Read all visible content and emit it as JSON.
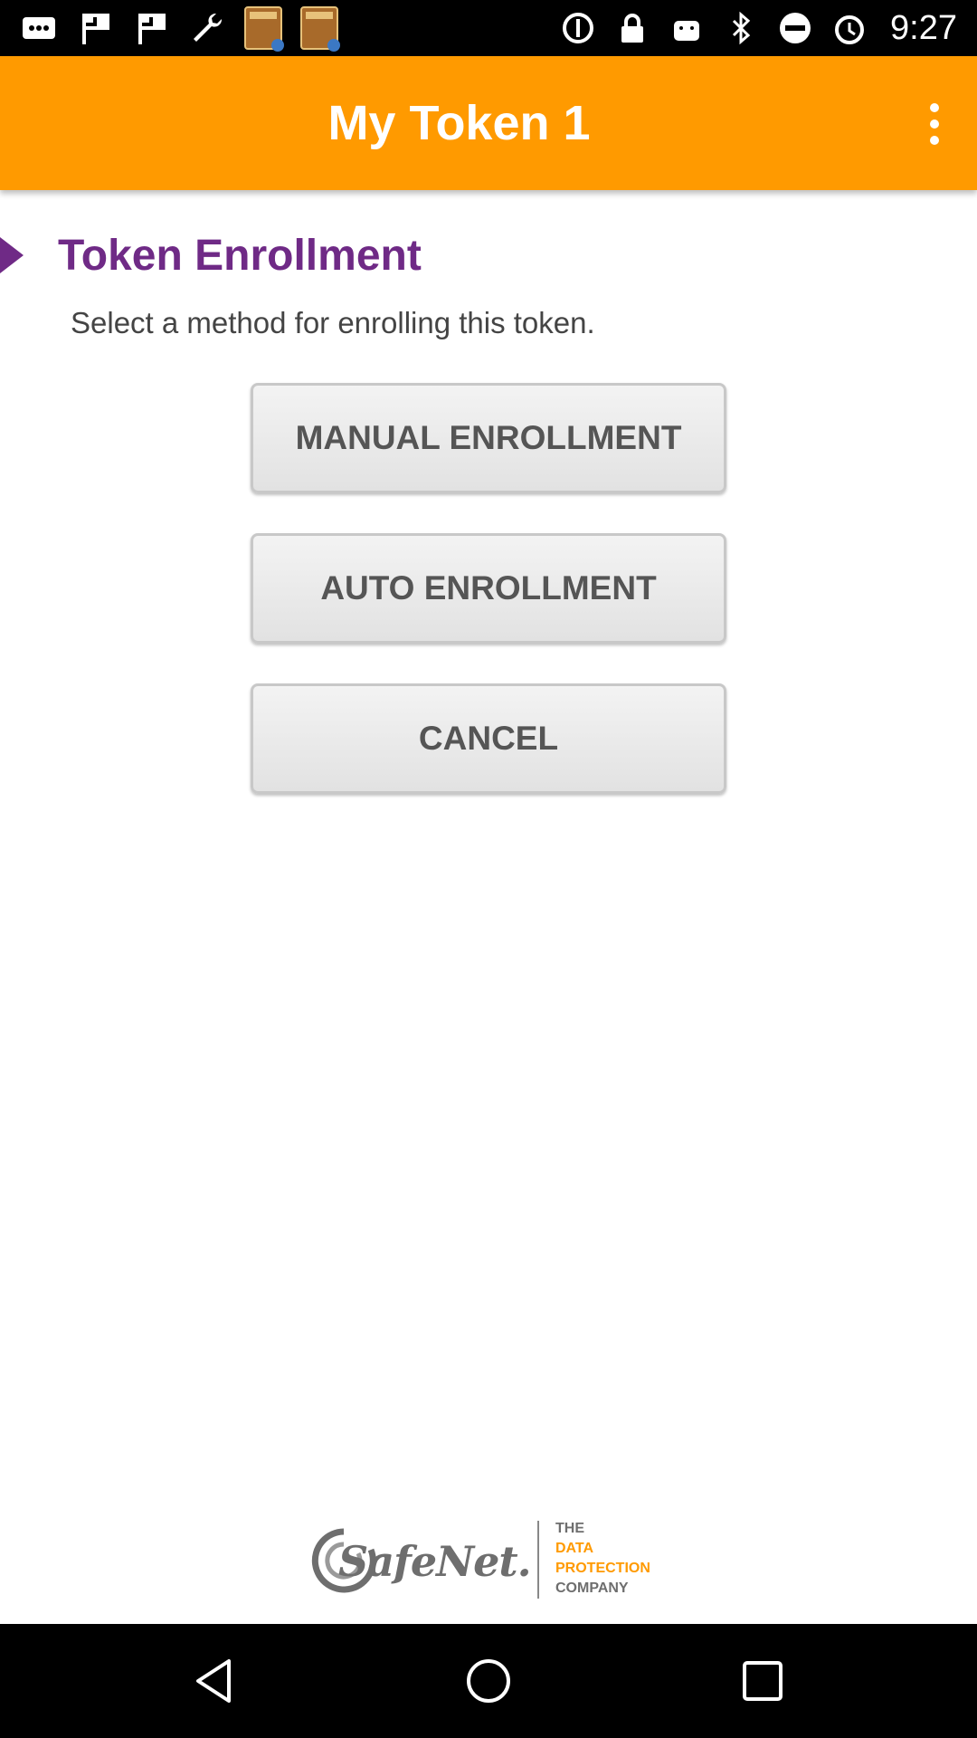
{
  "status_bar": {
    "left_icons": [
      "messages-icon",
      "flag-icon",
      "flag-icon",
      "wrench-icon",
      "topics-app-icon",
      "topics-app-icon"
    ],
    "right_icons": [
      "sync-icon",
      "lock-icon",
      "android-icon",
      "bluetooth-icon",
      "do-not-disturb-icon",
      "alarm-icon"
    ],
    "time": "9:27"
  },
  "app_bar": {
    "title": "My Token 1",
    "menu_icon": "overflow-menu-icon",
    "background_color": "#ff9a00"
  },
  "content": {
    "title": "Token Enrollment",
    "title_color": "#6f2a86",
    "subtitle": "Select a method for enrolling this token.",
    "buttons": {
      "manual": "MANUAL ENROLLMENT",
      "auto": "AUTO ENROLLMENT",
      "cancel": "CANCEL"
    }
  },
  "logo": {
    "brand": "SafeNet.",
    "tagline": {
      "line1": "THE",
      "line2": "DATA",
      "line3": "PROTECTION",
      "line4": "COMPANY"
    }
  },
  "nav_bar": {
    "icons": [
      "back-icon",
      "home-icon",
      "recent-apps-icon"
    ]
  }
}
